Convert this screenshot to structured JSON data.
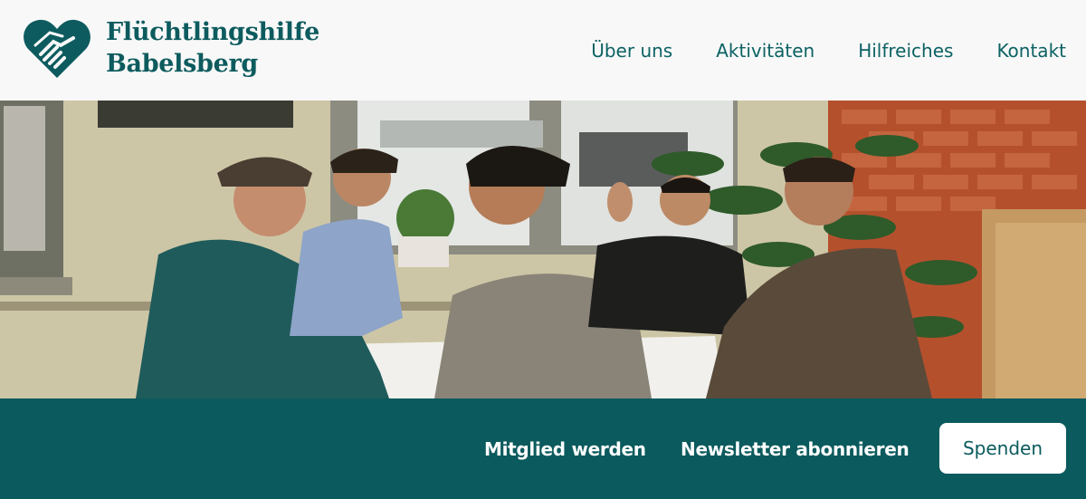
{
  "brand": {
    "name_line1": "Flüchtlingshilfe",
    "name_line2": "Babelsberg",
    "logo_icon": "heart-handshake-icon",
    "color": "#0d5b5e"
  },
  "nav": {
    "items": [
      {
        "label": "Über uns"
      },
      {
        "label": "Aktivitäten"
      },
      {
        "label": "Hilfreiches"
      },
      {
        "label": "Kontakt"
      }
    ]
  },
  "hero": {
    "alt": "Gruppenfoto am Tisch"
  },
  "cta_bar": {
    "member_label": "Mitglied werden",
    "newsletter_label": "Newsletter abonnieren",
    "donate_label": "Spenden",
    "background": "#0b5a5d"
  }
}
